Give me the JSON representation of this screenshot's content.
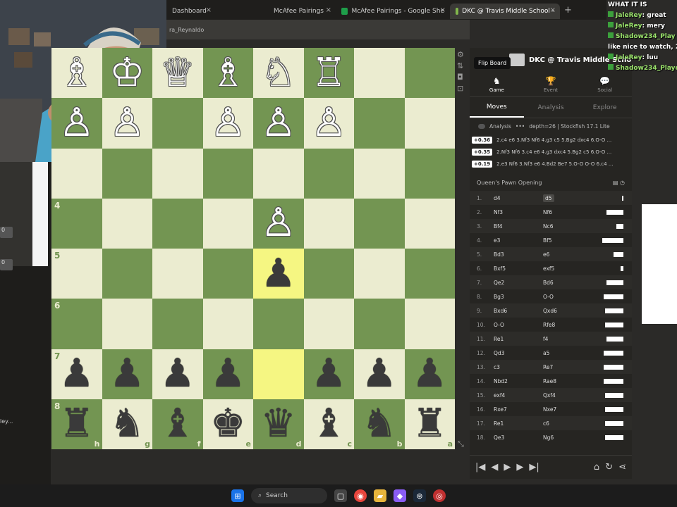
{
  "browser": {
    "tabs": [
      {
        "label": "Dashboard",
        "active": false
      },
      {
        "label": "McAfee Pairings",
        "active": false
      },
      {
        "label": "McAfee Pairings - Google She",
        "active": false
      },
      {
        "label": "DKC @ Travis Middle School -",
        "active": true
      }
    ],
    "new_tab": "+",
    "address": "ra_Reynaldo"
  },
  "board": {
    "ranks": [
      "",
      "",
      "",
      "4",
      "5",
      "6",
      "7",
      "8"
    ],
    "files": [
      "h",
      "g",
      "f",
      "e",
      "d",
      "c",
      "b",
      "a"
    ],
    "squares": [
      [
        "♗",
        "♔",
        "♕",
        "♗",
        "♘",
        "♖",
        "",
        ""
      ],
      [
        "♙",
        "♙",
        "",
        "♙",
        "♙",
        "♙",
        "",
        ""
      ],
      [
        "",
        "",
        "",
        "",
        "",
        "",
        "",
        ""
      ],
      [
        "",
        "",
        "",
        "",
        "♙",
        "",
        "",
        ""
      ],
      [
        "",
        "",
        "",
        "",
        "♟",
        "",
        "",
        ""
      ],
      [
        "",
        "",
        "",
        "",
        "",
        "",
        "",
        ""
      ],
      [
        "♟",
        "♟",
        "♟",
        "♟",
        "",
        "♟",
        "♟",
        "♟"
      ],
      [
        "♜",
        "♞",
        "♝",
        "♚",
        "♛",
        "♝",
        "♞",
        "♜"
      ]
    ]
  },
  "panel": {
    "title": "DKC @ Travis Middle Scho",
    "tooltip": "Flip Board",
    "top_tabs": [
      {
        "label": "Game",
        "icon": "♞"
      },
      {
        "label": "Event",
        "icon": "🏆"
      },
      {
        "label": "Social",
        "icon": "💬"
      }
    ],
    "sub_tabs": [
      "Moves",
      "Analysis",
      "Explore"
    ],
    "engine_label": "Analysis",
    "engine_depth": "depth=26 | Stockfish 17.1 Lite",
    "lines": [
      {
        "eval": "+0.36",
        "text": "2.c4 e6 3.Nf3 Nf6 4.g3 c5 5.Bg2 dxc4 6.O-O ..."
      },
      {
        "eval": "+0.35",
        "text": "2.Nf3 Nf6 3.c4 e6 4.g3 dxc4 5.Bg2 c5 6.O-O ..."
      },
      {
        "eval": "+0.19",
        "text": "2.e3 Nf6 3.Nf3 e6 4.Bd2 Be7 5.O-O O-O 6.c4 ..."
      }
    ],
    "opening": "Queen's Pawn Opening",
    "moves": [
      {
        "n": "1.",
        "w": "d4",
        "b": "d5",
        "bar": 2
      },
      {
        "n": "2.",
        "w": "Nf3",
        "b": "Nf6",
        "bar": 24
      },
      {
        "n": "3.",
        "w": "Bf4",
        "b": "Nc6",
        "bar": 10
      },
      {
        "n": "4.",
        "w": "e3",
        "b": "Bf5",
        "bar": 30
      },
      {
        "n": "5.",
        "w": "Bd3",
        "b": "e6",
        "bar": 14
      },
      {
        "n": "6.",
        "w": "Bxf5",
        "b": "exf5",
        "bar": 4
      },
      {
        "n": "7.",
        "w": "Qe2",
        "b": "Bd6",
        "bar": 24
      },
      {
        "n": "8.",
        "w": "Bg3",
        "b": "O-O",
        "bar": 28
      },
      {
        "n": "9.",
        "w": "Bxd6",
        "b": "Qxd6",
        "bar": 26
      },
      {
        "n": "10.",
        "w": "O-O",
        "b": "Rfe8",
        "bar": 26
      },
      {
        "n": "11.",
        "w": "Re1",
        "b": "f4",
        "bar": 24
      },
      {
        "n": "12.",
        "w": "Qd3",
        "b": "a5",
        "bar": 28
      },
      {
        "n": "13.",
        "w": "c3",
        "b": "Re7",
        "bar": 28
      },
      {
        "n": "14.",
        "w": "Nbd2",
        "b": "Rae8",
        "bar": 28
      },
      {
        "n": "15.",
        "w": "exf4",
        "b": "Qxf4",
        "bar": 26
      },
      {
        "n": "16.",
        "w": "Rxe7",
        "b": "Nxe7",
        "bar": 26
      },
      {
        "n": "17.",
        "w": "Re1",
        "b": "c6",
        "bar": 26
      },
      {
        "n": "18.",
        "w": "Qe3",
        "b": "Ng6",
        "bar": 26
      }
    ],
    "controls": {
      "first": "|◀",
      "prev": "◀",
      "play": "▶",
      "next": "▶",
      "last": "▶|"
    }
  },
  "chat": [
    {
      "name": "",
      "text": "WHAT IT IS"
    },
    {
      "name": "JaleRey",
      "text": ": great"
    },
    {
      "name": "JaleRey",
      "text": ": mery"
    },
    {
      "name": "Shadow234_Play",
      "text": ""
    },
    {
      "name": "",
      "text": "like nice to watch, 2"
    },
    {
      "name": "JaleRey",
      "text": ": luu"
    },
    {
      "name": "Shadow234_Playe",
      "text": ""
    }
  ],
  "left": {
    "user": "ley..."
  },
  "taskbar": {
    "search": "Search"
  }
}
